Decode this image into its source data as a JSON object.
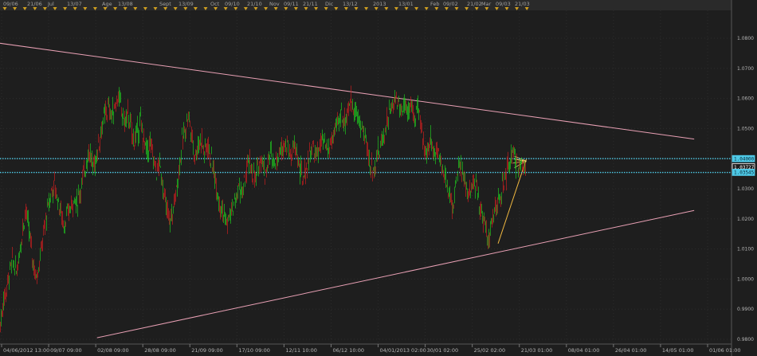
{
  "chart_data": {
    "type": "candlestick",
    "ylim": [
      0.98,
      1.09
    ],
    "y_ticks": [
      1.08,
      1.07,
      1.06,
      1.05,
      1.04,
      1.03,
      1.02,
      1.01,
      1.0,
      0.99,
      0.98
    ],
    "y_tick_labels": [
      "1.0800",
      "1.0700",
      "1.0600",
      "1.0500",
      "1.0400",
      "1.0300",
      "1.0200",
      "1.0100",
      "1.0000",
      "0.9900",
      "0.9800"
    ],
    "x_tick_labels": [
      "04/06/2012 13:00",
      "09/07 09:00",
      "02/08 09:00",
      "28/08 09:00",
      "21/09 09:00",
      "17/10 09:00",
      "12/11 10:00",
      "06/12 10:00",
      "04/01/2013 02:00",
      "30/01 02:00",
      "25/02 02:00",
      "21/03 01:00",
      "08/04 01:00",
      "26/04 01:00",
      "14/05 01:00",
      "01/06 01:00"
    ],
    "top_labels": [
      "09/06",
      "21/06",
      "Jul",
      "13/07",
      "Age",
      "13/08",
      "Sept",
      "13/09",
      "Oct",
      "09/10",
      "21/10",
      "Nov",
      "09/11",
      "21/11",
      "Dic",
      "13/12",
      "2013",
      "13/01",
      "Feb",
      "09/02",
      "21/02",
      "Mar",
      "09/03",
      "21/03"
    ],
    "horizontal_levels": [
      1.04,
      1.0354
    ],
    "price_badges": [
      {
        "label": "1.04000",
        "value": 1.04,
        "color": "#4ec9e6"
      },
      {
        "label": "1.03727",
        "value": 1.03727,
        "color": "#ffffff"
      },
      {
        "label": "1.03545",
        "value": 1.03545,
        "color": "#4ec9e6"
      }
    ],
    "trendlines": [
      {
        "name": "upper-channel",
        "from": [
          "2012-06-01",
          1.0785
        ],
        "to": [
          "2013-07-01",
          1.0465
        ],
        "color": "#e8a0b4"
      },
      {
        "name": "lower-channel",
        "from": [
          "2012-07-28",
          0.9805
        ],
        "to": [
          "2013-07-01",
          1.0228
        ],
        "color": "#e8a0b4"
      },
      {
        "name": "wedge-lower",
        "from": [
          "2013-03-12",
          1.0118
        ],
        "to": [
          "2013-03-28",
          1.0398
        ],
        "color": "#f0b840"
      },
      {
        "name": "wedge-upper",
        "from": [
          "2013-03-22",
          1.0398
        ],
        "to": [
          "2013-03-28",
          1.039
        ],
        "color": "#f0b840"
      }
    ],
    "series": [
      {
        "values": [
          [
            0,
            0.985
          ],
          [
            4,
            0.993
          ],
          [
            8,
            0.997
          ],
          [
            12,
            1.003
          ],
          [
            16,
            1.006
          ],
          [
            20,
            1.002
          ],
          [
            24,
            1.009
          ],
          [
            28,
            1.017
          ],
          [
            32,
            1.023
          ],
          [
            36,
            1.016
          ],
          [
            40,
            1.008
          ],
          [
            44,
            1.001
          ],
          [
            48,
            1.004
          ],
          [
            52,
            1.011
          ],
          [
            56,
            1.018
          ],
          [
            60,
            1.024
          ],
          [
            64,
            1.029
          ],
          [
            68,
            1.031
          ],
          [
            72,
            1.027
          ],
          [
            76,
            1.022
          ],
          [
            80,
            1.018
          ],
          [
            84,
            1.021
          ],
          [
            88,
            1.024
          ],
          [
            92,
            1.027
          ],
          [
            96,
            1.025
          ],
          [
            100,
            1.029
          ],
          [
            104,
            1.034
          ],
          [
            108,
            1.039
          ],
          [
            112,
            1.043
          ],
          [
            116,
            1.037
          ],
          [
            120,
            1.04
          ],
          [
            124,
            1.046
          ],
          [
            128,
            1.051
          ],
          [
            132,
            1.055
          ],
          [
            136,
            1.057
          ],
          [
            140,
            1.054
          ],
          [
            144,
            1.058
          ],
          [
            148,
            1.061
          ],
          [
            152,
            1.056
          ],
          [
            156,
            1.052
          ],
          [
            160,
            1.055
          ],
          [
            164,
            1.05
          ],
          [
            168,
            1.046
          ],
          [
            172,
            1.049
          ],
          [
            176,
            1.052
          ],
          [
            180,
            1.046
          ],
          [
            184,
            1.042
          ],
          [
            188,
            1.045
          ],
          [
            192,
            1.04
          ],
          [
            196,
            1.036
          ],
          [
            200,
            1.038
          ],
          [
            204,
            1.031
          ],
          [
            208,
            1.024
          ],
          [
            212,
            1.019
          ],
          [
            216,
            1.022
          ],
          [
            220,
            1.028
          ],
          [
            224,
            1.036
          ],
          [
            228,
            1.045
          ],
          [
            232,
            1.05
          ],
          [
            236,
            1.055
          ],
          [
            240,
            1.048
          ],
          [
            244,
            1.041
          ],
          [
            248,
            1.044
          ],
          [
            252,
            1.047
          ],
          [
            256,
            1.042
          ],
          [
            260,
            1.045
          ],
          [
            264,
            1.04
          ],
          [
            268,
            1.036
          ],
          [
            272,
            1.03
          ],
          [
            276,
            1.025
          ],
          [
            280,
            1.022
          ],
          [
            284,
            1.018
          ],
          [
            288,
            1.021
          ],
          [
            292,
            1.024
          ],
          [
            296,
            1.027
          ],
          [
            300,
            1.031
          ],
          [
            304,
            1.028
          ],
          [
            308,
            1.034
          ],
          [
            312,
            1.039
          ],
          [
            316,
            1.036
          ],
          [
            320,
            1.032
          ],
          [
            324,
            1.038
          ],
          [
            328,
            1.041
          ],
          [
            332,
            1.035
          ],
          [
            336,
            1.039
          ],
          [
            340,
            1.042
          ],
          [
            344,
            1.039
          ],
          [
            348,
            1.041
          ],
          [
            352,
            1.043
          ],
          [
            356,
            1.046
          ],
          [
            360,
            1.044
          ],
          [
            364,
            1.041
          ],
          [
            368,
            1.044
          ],
          [
            372,
            1.042
          ],
          [
            376,
            1.036
          ],
          [
            380,
            1.033
          ],
          [
            384,
            1.037
          ],
          [
            388,
            1.041
          ],
          [
            392,
            1.044
          ],
          [
            396,
            1.041
          ],
          [
            400,
            1.043
          ],
          [
            404,
            1.046
          ],
          [
            408,
            1.044
          ],
          [
            412,
            1.043
          ],
          [
            416,
            1.046
          ],
          [
            420,
            1.049
          ],
          [
            424,
            1.052
          ],
          [
            428,
            1.055
          ],
          [
            432,
            1.052
          ],
          [
            436,
            1.056
          ],
          [
            440,
            1.059
          ],
          [
            444,
            1.057
          ],
          [
            448,
            1.054
          ],
          [
            452,
            1.051
          ],
          [
            456,
            1.049
          ],
          [
            460,
            1.044
          ],
          [
            464,
            1.038
          ],
          [
            468,
            1.036
          ],
          [
            472,
            1.04
          ],
          [
            476,
            1.043
          ],
          [
            480,
            1.047
          ],
          [
            484,
            1.051
          ],
          [
            488,
            1.055
          ],
          [
            492,
            1.057
          ],
          [
            496,
            1.061
          ],
          [
            500,
            1.058
          ],
          [
            504,
            1.056
          ],
          [
            508,
            1.059
          ],
          [
            512,
            1.055
          ],
          [
            516,
            1.058
          ],
          [
            520,
            1.053
          ],
          [
            524,
            1.057
          ],
          [
            528,
            1.049
          ],
          [
            532,
            1.045
          ],
          [
            536,
            1.042
          ],
          [
            540,
            1.046
          ],
          [
            544,
            1.042
          ],
          [
            548,
            1.044
          ],
          [
            552,
            1.04
          ],
          [
            556,
            1.036
          ],
          [
            560,
            1.031
          ],
          [
            564,
            1.028
          ],
          [
            568,
            1.024
          ],
          [
            572,
            1.033
          ],
          [
            576,
            1.037
          ],
          [
            580,
            1.035
          ],
          [
            584,
            1.031
          ],
          [
            588,
            1.028
          ],
          [
            592,
            1.03
          ],
          [
            596,
            1.032
          ],
          [
            600,
            1.027
          ],
          [
            604,
            1.022
          ],
          [
            608,
            1.019
          ],
          [
            612,
            1.013
          ],
          [
            616,
            1.018
          ],
          [
            620,
            1.022
          ],
          [
            624,
            1.025
          ],
          [
            628,
            1.028
          ],
          [
            632,
            1.032
          ],
          [
            636,
            1.036
          ],
          [
            640,
            1.039
          ],
          [
            644,
            1.041
          ],
          [
            648,
            1.038
          ],
          [
            652,
            1.036
          ],
          [
            656,
            1.039
          ],
          [
            660,
            1.038
          ]
        ]
      }
    ]
  }
}
